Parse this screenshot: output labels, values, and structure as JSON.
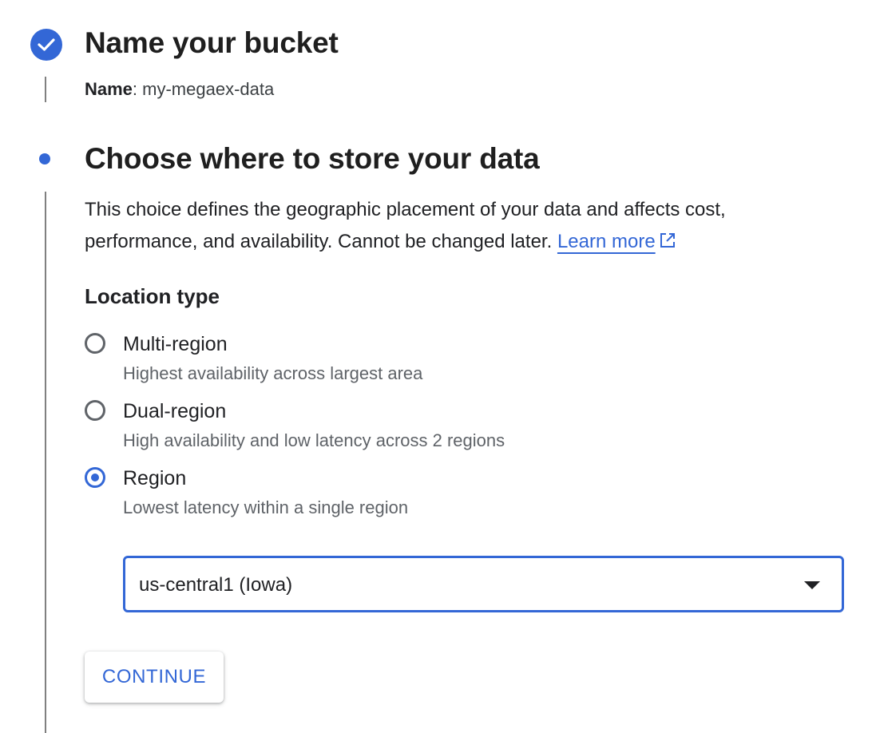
{
  "step1": {
    "title": "Name your bucket",
    "summary_label": "Name",
    "summary_sep": ":",
    "summary_value": " my-megaex-data"
  },
  "step2": {
    "title": "Choose where to store your data",
    "description": "This choice defines the geographic placement of your data and affects cost, performance, and availability. Cannot be changed later. ",
    "learn_more": "Learn more",
    "location_heading": "Location type",
    "options": [
      {
        "label": "Multi-region",
        "desc": "Highest availability across largest area",
        "selected": false
      },
      {
        "label": "Dual-region",
        "desc": "High availability and low latency across 2 regions",
        "selected": false
      },
      {
        "label": "Region",
        "desc": "Lowest latency within a single region",
        "selected": true
      }
    ],
    "region_select": {
      "value": "us-central1 (Iowa)"
    },
    "continue_label": "CONTINUE"
  },
  "icons": {
    "step1": "check-circle-icon",
    "step2": "step-dot-icon",
    "learn_more": "open-in-new-icon",
    "select": "arrow-drop-down-icon"
  },
  "colors": {
    "accent": "#3367d6",
    "text": "#202124",
    "secondary": "#5f6368",
    "line": "#808080"
  }
}
